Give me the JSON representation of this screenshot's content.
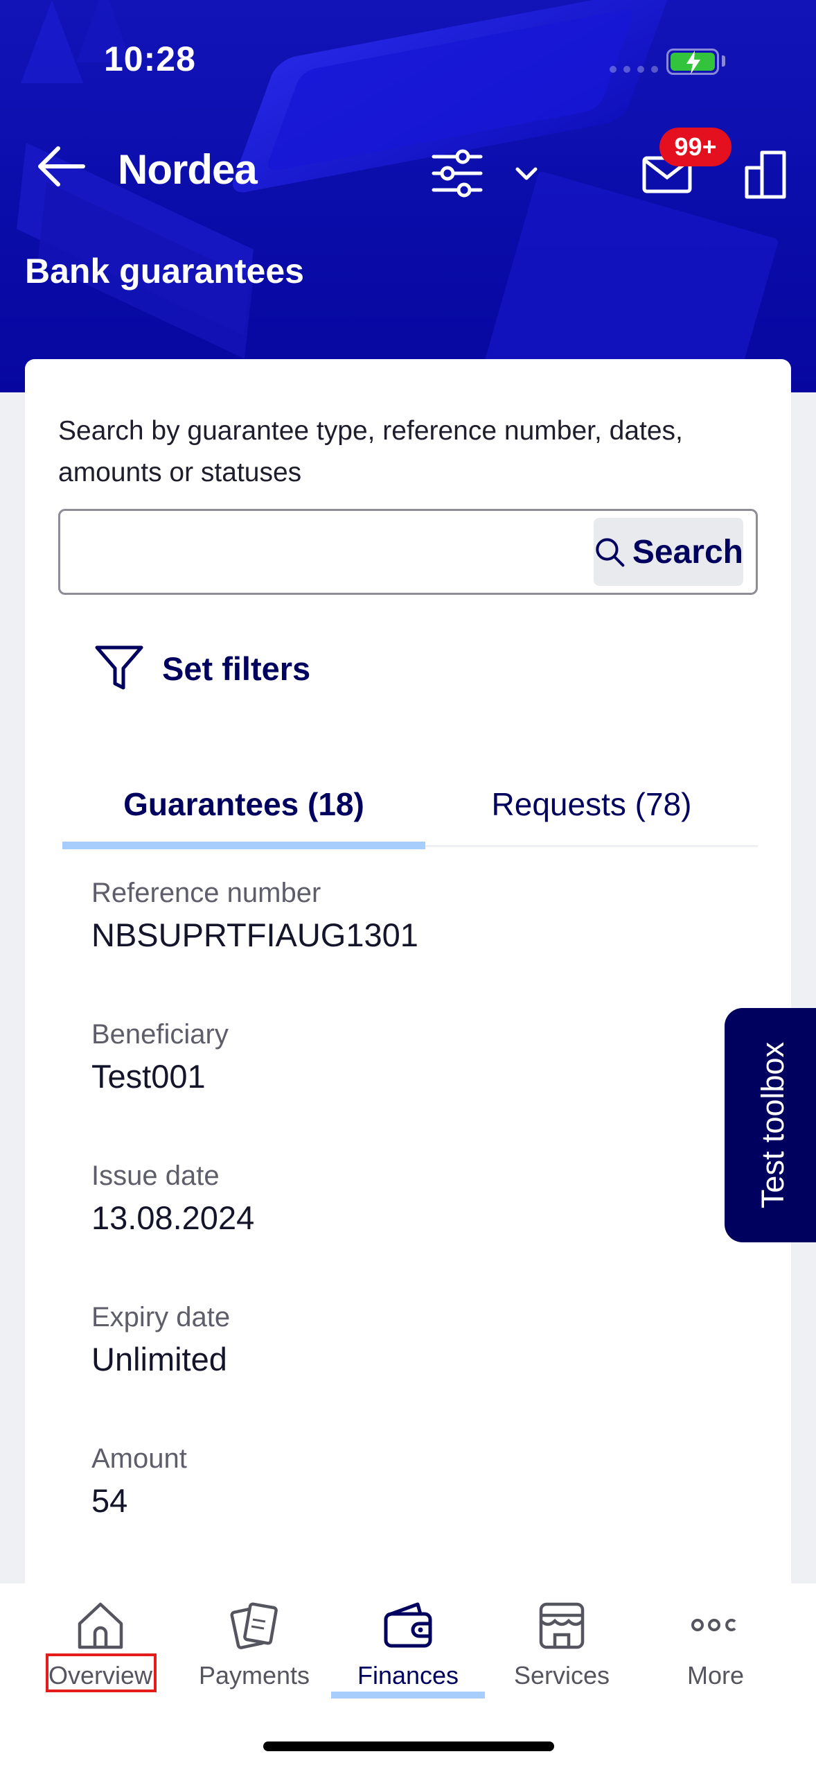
{
  "status_bar": {
    "time": "10:28"
  },
  "header": {
    "logo": "Nordea",
    "notification_count": "99+",
    "page_title": "Bank guarantees"
  },
  "search": {
    "hint": "Search by guarantee type, reference number, dates, amounts or statuses",
    "input_value": "",
    "button_label": "Search"
  },
  "filters": {
    "label": "Set filters"
  },
  "tabs": [
    {
      "label": "Guarantees (18)",
      "active": true
    },
    {
      "label": "Requests (78)",
      "active": false
    }
  ],
  "guarantee": {
    "fields": [
      {
        "label": "Reference number",
        "value": "NBSUPRTFIAUG1301"
      },
      {
        "label": "Beneficiary",
        "value": "Test001"
      },
      {
        "label": "Issue date",
        "value": "13.08.2024"
      },
      {
        "label": "Expiry date",
        "value": "Unlimited"
      },
      {
        "label": "Amount",
        "value": "54"
      }
    ]
  },
  "side_tab": {
    "label": "Test toolbox"
  },
  "bottom_nav": {
    "items": [
      {
        "label": "Overview",
        "icon": "home-icon"
      },
      {
        "label": "Payments",
        "icon": "payments-icon"
      },
      {
        "label": "Finances",
        "icon": "wallet-icon",
        "active": true
      },
      {
        "label": "Services",
        "icon": "store-icon"
      },
      {
        "label": "More",
        "icon": "more-icon"
      }
    ]
  },
  "colors": {
    "brand_blue": "#00005e",
    "header_blue": "#0a0ca8",
    "accent_light_blue": "#a6cdfb",
    "badge_red": "#e4101f"
  }
}
